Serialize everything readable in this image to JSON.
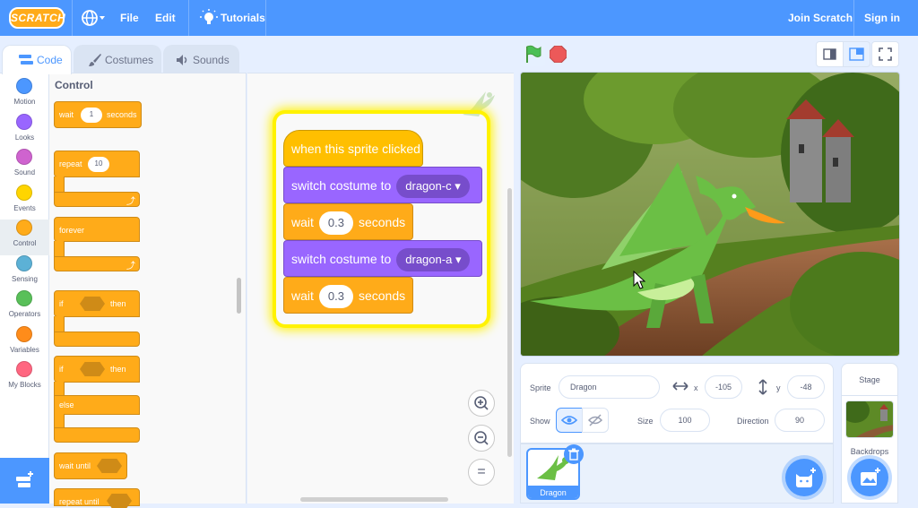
{
  "menu": {
    "logo_text": "SCRATCH",
    "file": "File",
    "edit": "Edit",
    "tutorials": "Tutorials",
    "join": "Join Scratch",
    "signin": "Sign in"
  },
  "tabs": {
    "code": "Code",
    "costumes": "Costumes",
    "sounds": "Sounds"
  },
  "categories": [
    {
      "label": "Motion",
      "color": "#4c97ff"
    },
    {
      "label": "Looks",
      "color": "#9966ff"
    },
    {
      "label": "Sound",
      "color": "#cf63cf"
    },
    {
      "label": "Events",
      "color": "#ffd500"
    },
    {
      "label": "Control",
      "color": "#ffab19"
    },
    {
      "label": "Sensing",
      "color": "#5cb1d6"
    },
    {
      "label": "Operators",
      "color": "#59c059"
    },
    {
      "label": "Variables",
      "color": "#ff8c1a"
    },
    {
      "label": "My Blocks",
      "color": "#ff6680"
    }
  ],
  "palette": {
    "title": "Control",
    "wait": "wait",
    "wait_value": "1",
    "seconds": "seconds",
    "repeat": "repeat",
    "repeat_value": "10",
    "forever": "forever",
    "if": "if",
    "then": "then",
    "if2": "if",
    "then2": "then",
    "else": "else",
    "wait_until": "wait until",
    "repeat_until": "repeat until"
  },
  "script": {
    "hat": "when this sprite clicked",
    "switch1": "switch costume to",
    "costume1": "dragon-c",
    "wait1": "wait",
    "wait1_value": "0.3",
    "seconds1": "seconds",
    "switch2": "switch costume to",
    "costume2": "dragon-a",
    "wait2": "wait",
    "wait2_value": "0.3",
    "seconds2": "seconds"
  },
  "zoom": {
    "in": "+",
    "out": "−",
    "reset": "="
  },
  "sprite_info": {
    "sprite_label": "Sprite",
    "sprite_name": "Dragon",
    "x_label": "x",
    "x_value": "-105",
    "y_label": "y",
    "y_value": "-48",
    "show_label": "Show",
    "size_label": "Size",
    "size_value": "100",
    "direction_label": "Direction",
    "direction_value": "90"
  },
  "sprite_list": [
    {
      "name": "Dragon"
    }
  ],
  "stage_panel": {
    "title": "Stage",
    "backdrops": "Backdrops"
  },
  "colors": {
    "menubar": "#4c97ff",
    "control": "#ffab19",
    "looks": "#9966ff",
    "events": "#ffbf00"
  }
}
